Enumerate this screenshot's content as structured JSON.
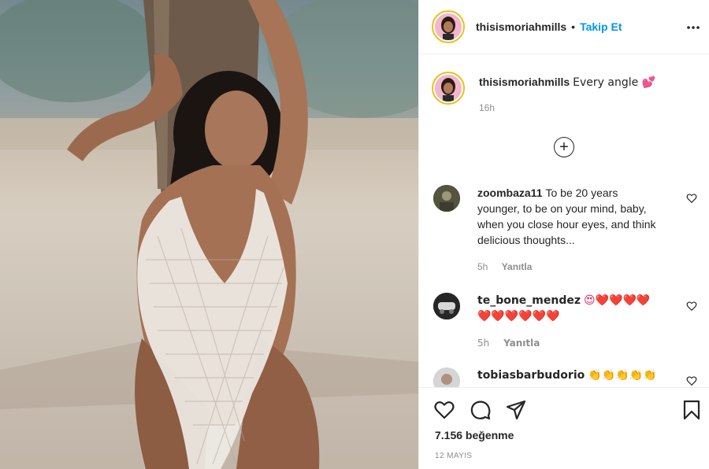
{
  "post": {
    "author": "thisismoriahmills",
    "follow_label": "Takip Et",
    "separator": "•",
    "more_label": "•••"
  },
  "caption": {
    "username": "thisismoriahmills",
    "text": "Every angle 💕",
    "time": "16h"
  },
  "load_more_label": "+",
  "comments": [
    {
      "username": "zoombaza11",
      "text": "To be 20 years younger, to be on your mind, baby, when you close hour eyes, and think delicious thoughts...",
      "time": "5h",
      "reply_label": "Yanıtla",
      "avatar_color": "#4a4a3a"
    },
    {
      "username": "te_bone_mendez",
      "text": "😍❤️❤️❤️❤️❤️❤️❤️❤️❤️❤️",
      "time": "5h",
      "reply_label": "Yanıtla",
      "avatar_color": "#2e2e2e"
    },
    {
      "username": "tobiasbarbudorio",
      "text": "👏👏👏👏👏",
      "avatar_color": "#c8c8c8"
    }
  ],
  "footer": {
    "likes": "7.156 beğenme",
    "date": "12 MAYIS"
  },
  "colors": {
    "accent": "#0095f6",
    "text": "#262626",
    "muted": "#8e8e8e",
    "story_ring": "#e9c21b"
  }
}
